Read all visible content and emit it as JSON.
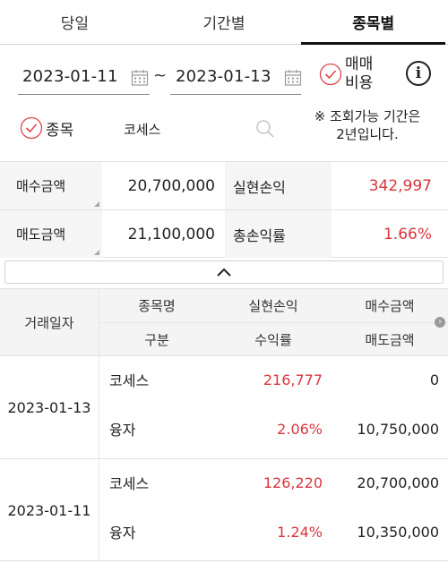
{
  "tabs": [
    {
      "label": "당일",
      "active": false
    },
    {
      "label": "기간별",
      "active": false
    },
    {
      "label": "종목별",
      "active": true
    }
  ],
  "date_range": {
    "start": "2023-01-11",
    "separator": "~",
    "end": "2023-01-13"
  },
  "fee_option": {
    "label_line1": "매매",
    "label_line2": "비용",
    "checked": true
  },
  "info_icon": "info-icon",
  "stock_filter": {
    "label": "종목",
    "checked": true,
    "name": "코세스"
  },
  "notice": {
    "line1": "※ 조회가능 기간은",
    "line2": "2년입니다."
  },
  "summary": {
    "buy_amount_label": "매수금액",
    "buy_amount": "20,700,000",
    "realized_pl_label": "실현손익",
    "realized_pl": "342,997",
    "sell_amount_label": "매도금액",
    "sell_amount": "21,100,000",
    "total_return_label": "총손익률",
    "total_return": "1.66%"
  },
  "table": {
    "headers": {
      "trade_date": "거래일자",
      "stock_name": "종목명",
      "category": "구분",
      "realized_pl": "실현손익",
      "return_rate": "수익률",
      "buy_amount": "매수금액",
      "sell_amount": "매도금액"
    },
    "rows": [
      {
        "date": "2023-01-13",
        "name": "코세스",
        "realized_pl": "216,777",
        "buy_amount": "0",
        "category": "융자",
        "return_rate": "2.06%",
        "sell_amount": "10,750,000"
      },
      {
        "date": "2023-01-11",
        "name": "코세스",
        "realized_pl": "126,220",
        "buy_amount": "20,700,000",
        "category": "융자",
        "return_rate": "1.24%",
        "sell_amount": "10,350,000"
      }
    ]
  },
  "colors": {
    "accent_red": "#d9363e",
    "check_red": "#e0454f",
    "header_bg": "#f4f4f4"
  }
}
